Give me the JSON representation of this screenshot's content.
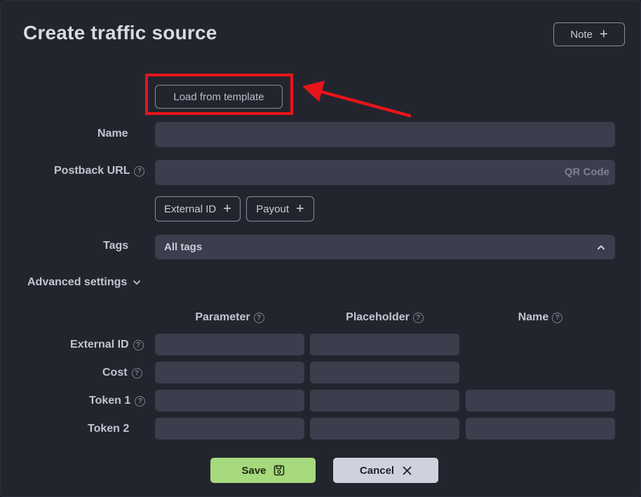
{
  "modal": {
    "title": "Create traffic source",
    "note_button": "Note"
  },
  "template": {
    "button_label": "Load from template"
  },
  "form": {
    "name_label": "Name",
    "postback_label": "Postback URL",
    "qr_code": "QR Code",
    "chips": {
      "external_id": "External ID",
      "payout": "Payout"
    },
    "tags_label": "Tags",
    "tags_value": "All tags"
  },
  "advanced": {
    "label": "Advanced settings",
    "columns": {
      "parameter": "Parameter",
      "placeholder": "Placeholder",
      "name": "Name"
    },
    "rows": [
      {
        "label": "External ID"
      },
      {
        "label": "Cost"
      },
      {
        "label": "Token 1"
      },
      {
        "label": "Token 2"
      }
    ]
  },
  "footer": {
    "save": "Save",
    "cancel": "Cancel"
  },
  "colors": {
    "accent_save": "#a6d97c",
    "highlight": "#e8141b",
    "background": "#23252e",
    "field": "#3b3e4c"
  },
  "icons": [
    "plus-icon",
    "help-icon",
    "chevron-up-icon",
    "chevron-down-icon",
    "save-icon",
    "close-icon",
    "arrow-annotation"
  ]
}
